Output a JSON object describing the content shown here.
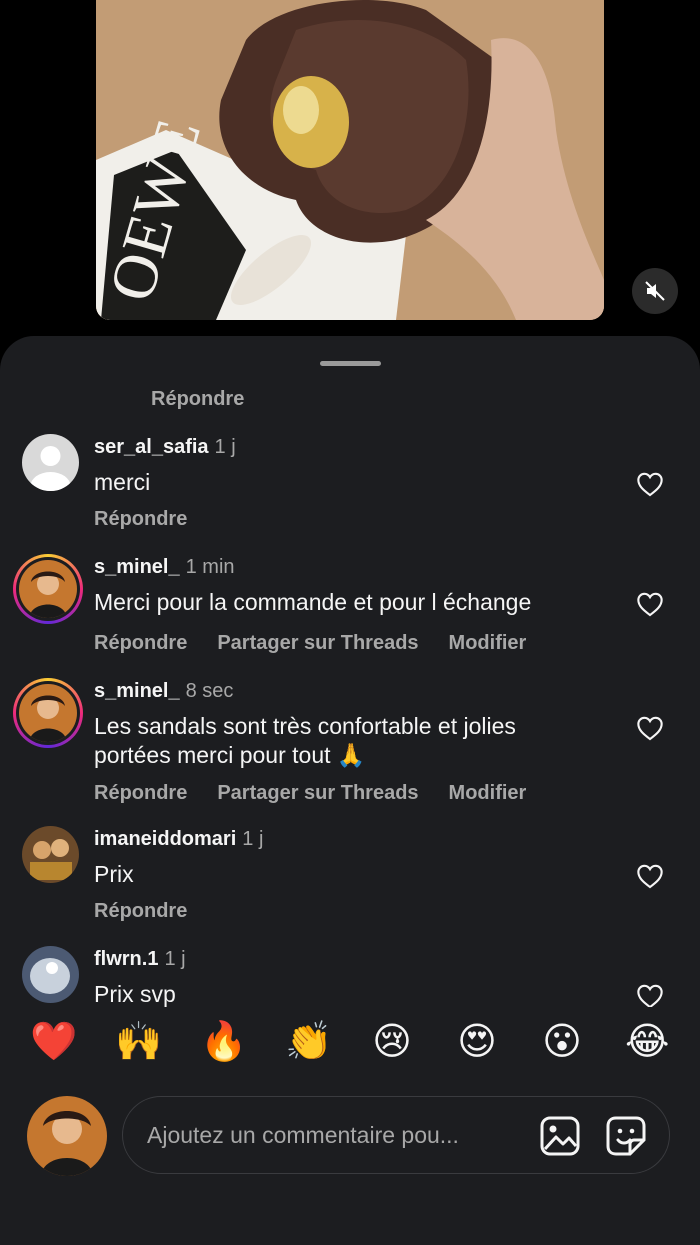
{
  "video": {
    "mute_icon": "speaker-muted-icon",
    "magazine_text": "OEWE"
  },
  "sheet": {
    "reply_top": "Répondre"
  },
  "comments": [
    {
      "username": "ser_al_safia",
      "time": "1 j",
      "text": "merci",
      "actions": [
        "Répondre"
      ]
    },
    {
      "username": "s_minel_",
      "time": "1 min",
      "text": "Merci pour la commande et pour l échange",
      "actions": [
        "Répondre",
        "Partager sur Threads",
        "Modifier"
      ]
    },
    {
      "username": "s_minel_",
      "time": "8 sec",
      "text": "Les sandals sont très confortable et jolies portées merci pour tout 🙏",
      "actions": [
        "Répondre",
        "Partager sur Threads",
        "Modifier"
      ]
    },
    {
      "username": "imaneiddomari",
      "time": "1 j",
      "text": "Prix",
      "actions": [
        "Répondre"
      ]
    },
    {
      "username": "flwrn.1",
      "time": "1 j",
      "text": "Prix svp",
      "actions": []
    }
  ],
  "emoji_bar": [
    "❤️",
    "🙌",
    "🔥",
    "👏",
    "😢",
    "😍",
    "😮",
    "😂"
  ],
  "composer": {
    "placeholder": "Ajoutez un commentaire pou...",
    "icons": [
      "image-icon",
      "sticker-icon"
    ]
  },
  "colors": {
    "sheet_bg": "#1c1d20",
    "secondary_text": "#a8a8a8",
    "primary_text": "#f5f5f5"
  }
}
